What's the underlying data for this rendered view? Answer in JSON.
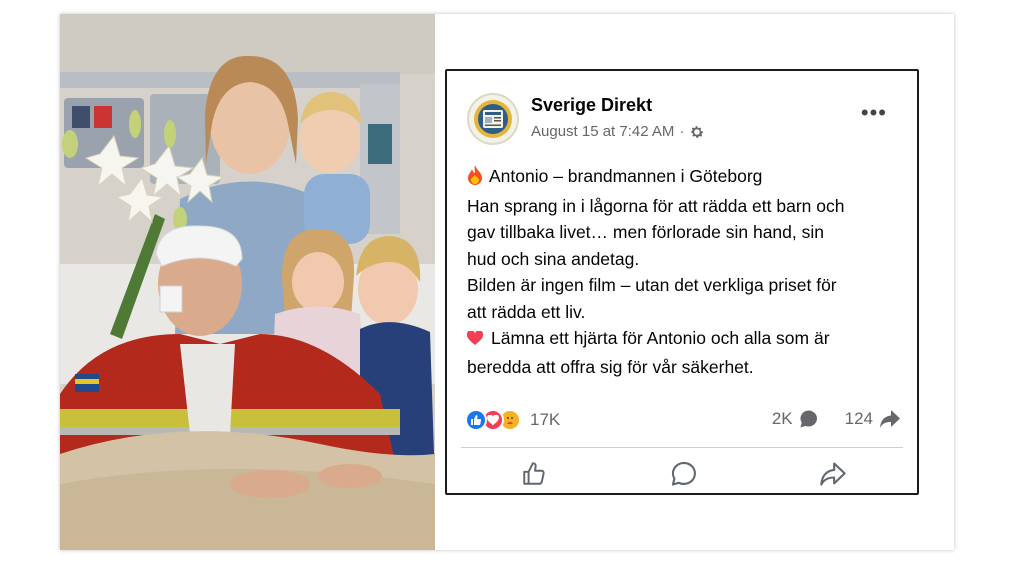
{
  "post": {
    "page_name": "Sverige Direkt",
    "timestamp": "August 15 at 7:42 AM",
    "separator": "·",
    "audience_icon": "gear-icon",
    "more_label": "•••",
    "text_lines": [
      "Antonio – brandmannen i Göteborg",
      "Han sprang in i lågorna för att rädda ett barn och",
      "gav tillbaka livet… men förlorade sin hand, sin",
      "hud och sina andetag.",
      "Bilden är ingen film – utan det verkliga priset för",
      "att rädda ett liv.",
      "Lämna ett hjärta för Antonio och alla som är",
      "beredda att offra sig för vår säkerhet."
    ],
    "reactions": {
      "icons": [
        "like-icon",
        "love-icon",
        "care-icon"
      ],
      "count": "17K"
    },
    "comments_count": "2K",
    "shares_count": "124",
    "actions": [
      "like-button",
      "comment-button",
      "share-button"
    ]
  },
  "colors": {
    "like_blue": "#1877f2",
    "love_red": "#f33e58",
    "care_yellow": "#f7b125",
    "meta_gray": "#65676b"
  }
}
